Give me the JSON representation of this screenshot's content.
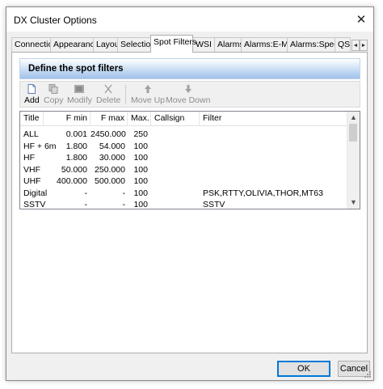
{
  "window": {
    "title": "DX Cluster Options",
    "close_glyph": "✕"
  },
  "tabs": [
    {
      "label": "Connection",
      "active": false
    },
    {
      "label": "Appearance",
      "active": false
    },
    {
      "label": "Layout",
      "active": false
    },
    {
      "label": "Selection",
      "active": false
    },
    {
      "label": "Spot Filters",
      "active": true
    },
    {
      "label": "WSI",
      "active": false
    },
    {
      "label": "Alarms",
      "active": false
    },
    {
      "label": "Alarms:E-Mail",
      "active": false
    },
    {
      "label": "Alarms:Speech",
      "active": false
    },
    {
      "label": "QSL",
      "active": false
    }
  ],
  "tab_scroll": {
    "left": "◄",
    "right": "►"
  },
  "panel": {
    "header": "Define the spot filters"
  },
  "toolbar": {
    "add": "Add",
    "copy": "Copy",
    "modify": "Modify",
    "delete": "Delete",
    "move_up": "Move Up",
    "move_down": "Move Down"
  },
  "grid": {
    "columns": [
      "Title",
      "F min",
      "F max",
      "Max.",
      "Callsign",
      "Filter"
    ],
    "rows": [
      [
        "ALL",
        "0.001",
        "2450.000",
        "250",
        "",
        ""
      ],
      [
        "HF + 6m",
        "1.800",
        "54.000",
        "100",
        "",
        ""
      ],
      [
        "HF",
        "1.800",
        "30.000",
        "100",
        "",
        ""
      ],
      [
        "VHF",
        "50.000",
        "250.000",
        "100",
        "",
        ""
      ],
      [
        "UHF",
        "400.000",
        "500.000",
        "100",
        "",
        ""
      ],
      [
        "Digital",
        "-",
        "-",
        "100",
        "",
        "PSK,RTTY,OLIVIA,THOR,MT63"
      ],
      [
        "SSTV",
        "-",
        "-",
        "100",
        "",
        "SSTV"
      ]
    ],
    "scroll_up": "▲",
    "scroll_down": "▼"
  },
  "buttons": {
    "ok": "OK",
    "cancel": "Cancel"
  },
  "colors": {
    "header_band": "#9fc2ea",
    "default_button_border": "#0078d7",
    "dialog_bg": "#f0f0f0"
  }
}
